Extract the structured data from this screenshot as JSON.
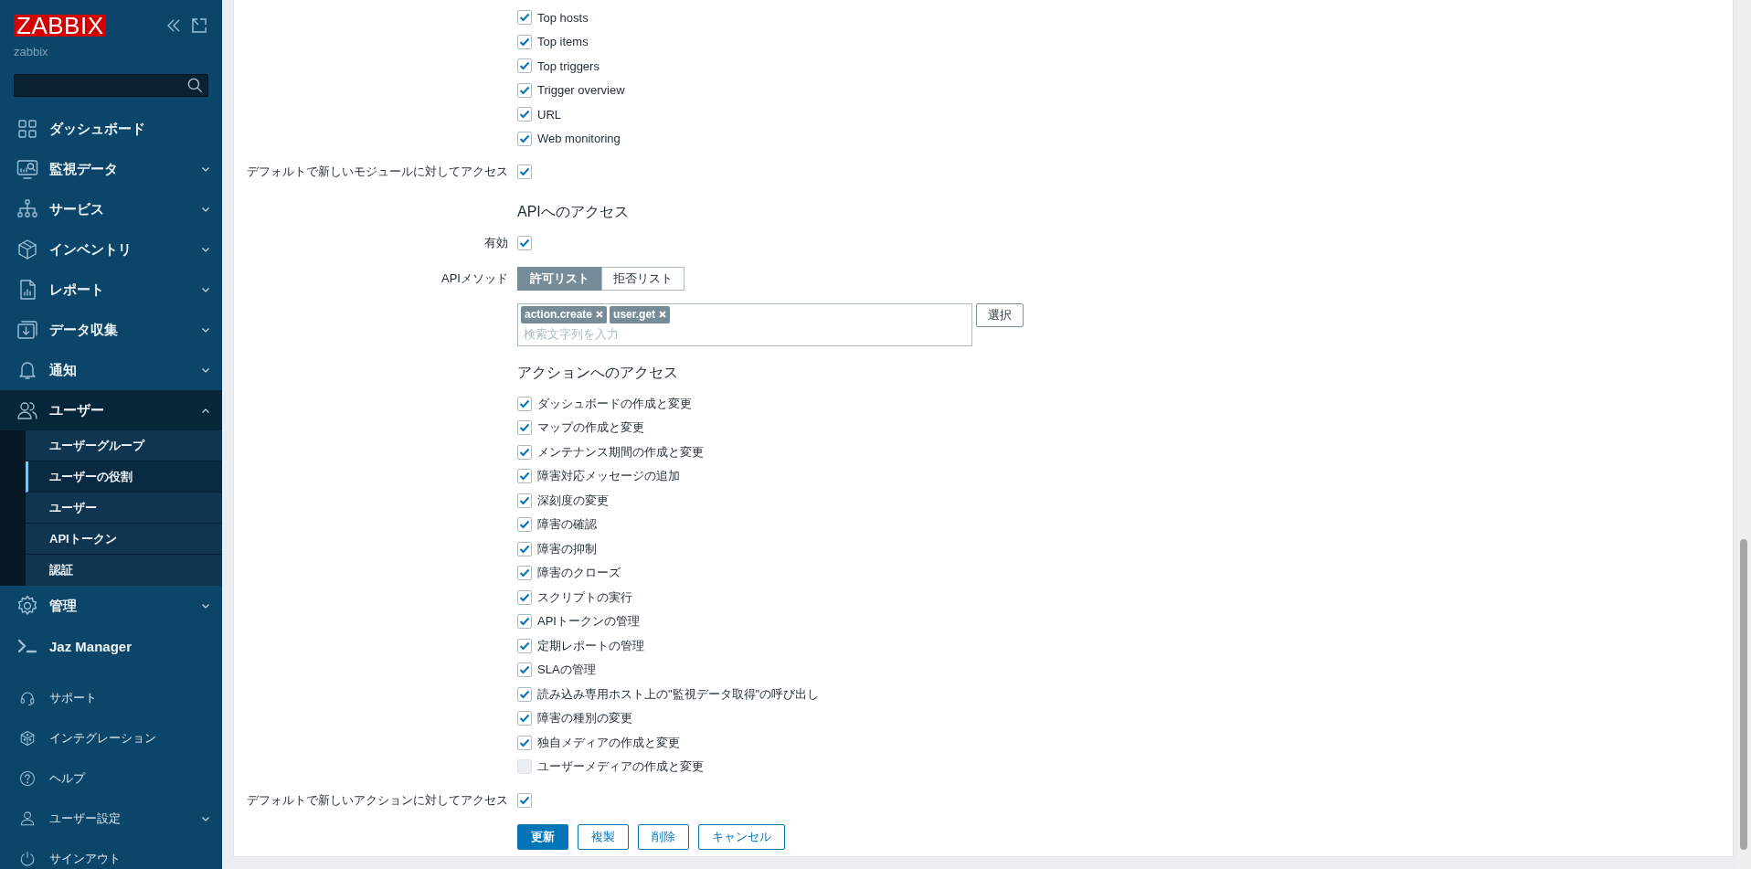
{
  "sidebar": {
    "logo": "ZABBIX",
    "server_name": "zabbix",
    "menu": [
      {
        "label": "ダッシュボード",
        "has_submenu": false,
        "expanded": false
      },
      {
        "label": "監視データ",
        "has_submenu": true,
        "expanded": false
      },
      {
        "label": "サービス",
        "has_submenu": true,
        "expanded": false
      },
      {
        "label": "インベントリ",
        "has_submenu": true,
        "expanded": false
      },
      {
        "label": "レポート",
        "has_submenu": true,
        "expanded": false
      },
      {
        "label": "データ収集",
        "has_submenu": true,
        "expanded": false
      },
      {
        "label": "通知",
        "has_submenu": true,
        "expanded": false
      },
      {
        "label": "ユーザー",
        "has_submenu": true,
        "expanded": true,
        "children": [
          {
            "label": "ユーザーグループ",
            "selected": false
          },
          {
            "label": "ユーザーの役割",
            "selected": true
          },
          {
            "label": "ユーザー",
            "selected": false
          },
          {
            "label": "APIトークン",
            "selected": false
          },
          {
            "label": "認証",
            "selected": false
          }
        ]
      },
      {
        "label": "管理",
        "has_submenu": true,
        "expanded": false
      },
      {
        "label": "Jaz Manager",
        "has_submenu": false,
        "expanded": false
      }
    ],
    "bottom_menu": [
      {
        "label": "サポート",
        "has_submenu": false
      },
      {
        "label": "インテグレーション",
        "has_submenu": false
      },
      {
        "label": "ヘルプ",
        "has_submenu": false
      },
      {
        "label": "ユーザー設定",
        "has_submenu": true
      },
      {
        "label": "サインアウト",
        "has_submenu": false
      }
    ]
  },
  "form": {
    "modules": [
      {
        "label": "Top hosts",
        "checked": true
      },
      {
        "label": "Top items",
        "checked": true
      },
      {
        "label": "Top triggers",
        "checked": true
      },
      {
        "label": "Trigger overview",
        "checked": true
      },
      {
        "label": "URL",
        "checked": true
      },
      {
        "label": "Web monitoring",
        "checked": true
      }
    ],
    "default_modules": {
      "label": "デフォルトで新しいモジュールに対してアクセス",
      "checked": true
    },
    "api_access": {
      "title": "APIへのアクセス",
      "enabled": {
        "label": "有効",
        "checked": true
      },
      "methods": {
        "label": "APIメソッド",
        "modes": [
          {
            "label": "許可リスト",
            "selected": true
          },
          {
            "label": "拒否リスト",
            "selected": false
          }
        ],
        "tags": [
          "action.create",
          "user.get"
        ],
        "placeholder": "検索文字列を入力",
        "select_button": "選択"
      }
    },
    "action_access": {
      "title": "アクションへのアクセス",
      "actions": [
        {
          "label": "ダッシュボードの作成と変更",
          "checked": true,
          "disabled": false
        },
        {
          "label": "マップの作成と変更",
          "checked": true,
          "disabled": false
        },
        {
          "label": "メンテナンス期間の作成と変更",
          "checked": true,
          "disabled": false
        },
        {
          "label": "障害対応メッセージの追加",
          "checked": true,
          "disabled": false
        },
        {
          "label": "深刻度の変更",
          "checked": true,
          "disabled": false
        },
        {
          "label": "障害の確認",
          "checked": true,
          "disabled": false
        },
        {
          "label": "障害の抑制",
          "checked": true,
          "disabled": false
        },
        {
          "label": "障害のクローズ",
          "checked": true,
          "disabled": false
        },
        {
          "label": "スクリプトの実行",
          "checked": true,
          "disabled": false
        },
        {
          "label": "APIトークンの管理",
          "checked": true,
          "disabled": false
        },
        {
          "label": "定期レポートの管理",
          "checked": true,
          "disabled": false
        },
        {
          "label": "SLAの管理",
          "checked": true,
          "disabled": false
        },
        {
          "label": "読み込み専用ホスト上の\"監視データ取得\"の呼び出し",
          "checked": true,
          "disabled": false
        },
        {
          "label": "障害の種別の変更",
          "checked": true,
          "disabled": false
        },
        {
          "label": "独自メディアの作成と変更",
          "checked": true,
          "disabled": false
        },
        {
          "label": "ユーザーメディアの作成と変更",
          "checked": false,
          "disabled": true
        }
      ]
    },
    "default_actions": {
      "label": "デフォルトで新しいアクションに対してアクセス",
      "checked": true
    },
    "buttons": [
      {
        "label": "更新",
        "kind": "primary"
      },
      {
        "label": "複製",
        "kind": "secondary"
      },
      {
        "label": "削除",
        "kind": "secondary"
      },
      {
        "label": "キャンセル",
        "kind": "secondary"
      }
    ]
  }
}
